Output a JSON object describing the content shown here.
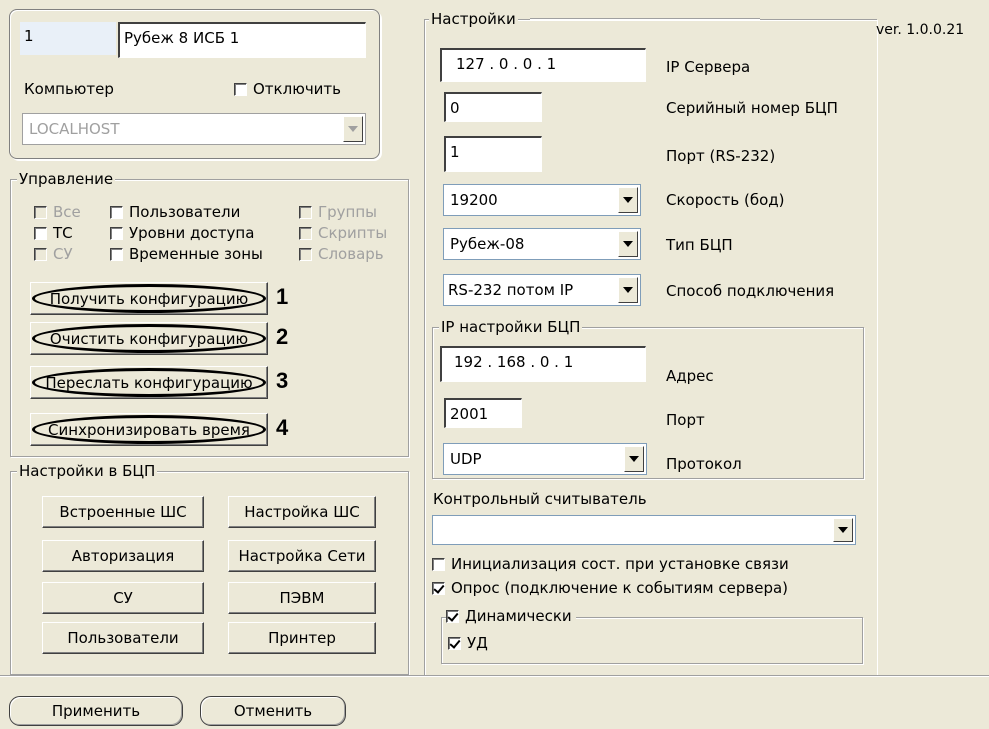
{
  "version": "ver. 1.0.0.21",
  "object": {
    "id": "1",
    "name": "Рубеж 8 ИСБ 1",
    "computer_label": "Компьютер",
    "disable_label": "Отключить",
    "computer_value": "LOCALHOST"
  },
  "management": {
    "title": "Управление",
    "checkboxes": [
      {
        "label": "Все",
        "checked": false,
        "disabled": true
      },
      {
        "label": "Пользователи",
        "checked": false,
        "disabled": false
      },
      {
        "label": "Группы",
        "checked": false,
        "disabled": true
      },
      {
        "label": "ТС",
        "checked": false,
        "disabled": false
      },
      {
        "label": "Уровни доступа",
        "checked": false,
        "disabled": false
      },
      {
        "label": "Скрипты",
        "checked": false,
        "disabled": true
      },
      {
        "label": "СУ",
        "checked": false,
        "disabled": true
      },
      {
        "label": "Временные зоны",
        "checked": false,
        "disabled": false
      },
      {
        "label": "Словарь",
        "checked": false,
        "disabled": true
      }
    ],
    "buttons": [
      {
        "label": "Получить конфигурацию",
        "number": "1"
      },
      {
        "label": "Очистить конфигурацию",
        "number": "2"
      },
      {
        "label": "Переслать конфигурацию",
        "number": "3"
      },
      {
        "label": "Синхронизировать время",
        "number": "4"
      }
    ]
  },
  "bcp_settings": {
    "title": "Настройки в БЦП",
    "buttons": [
      "Встроенные ШС",
      "Настройка ШС",
      "Авторизация",
      "Настройка Сети",
      "СУ",
      "ПЭВМ",
      "Пользователи",
      "Принтер"
    ]
  },
  "settings": {
    "title": "Настройки",
    "server_ip": "127 .  0  .  0  .  1",
    "server_ip_label": "IP Сервера",
    "serial": "0",
    "serial_label": "Серийный номер БЦП",
    "port": "1",
    "port_label": "Порт (RS-232)",
    "speed": "19200",
    "speed_label": "Скорость (бод)",
    "type": "Рубеж-08",
    "type_label": "Тип БЦП",
    "connection": "RS-232 потом IP",
    "connection_label": "Способ подключения"
  },
  "ip_settings": {
    "title": "IP настройки БЦП",
    "address": "192 . 168 .  0  .  1",
    "address_label": "Адрес",
    "port": "2001",
    "port_label": "Порт",
    "protocol": "UDP",
    "protocol_label": "Протокол"
  },
  "reader": {
    "label": "Контрольный считыватель",
    "value": "",
    "init_label": "Инициализация сост. при установке связи",
    "init_checked": false,
    "poll_label": "Опрос (подключение к событиям сервера)",
    "poll_checked": true,
    "dynamic_label": "Динамически",
    "dynamic_checked": true,
    "ud_label": "УД",
    "ud_checked": true
  },
  "footer": {
    "apply_label": "Применить",
    "cancel_label": "Отменить"
  }
}
